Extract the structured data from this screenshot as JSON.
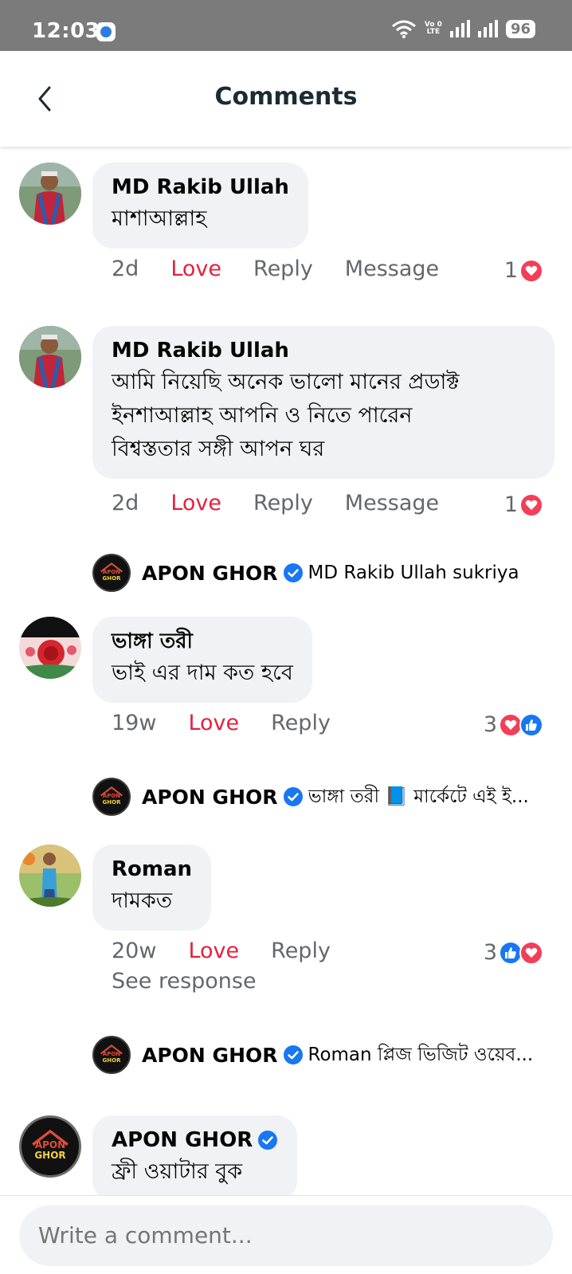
{
  "status_bar": {
    "time": "12:03",
    "lte_top": "Vo 0",
    "lte_bottom": "LTE",
    "battery": "96"
  },
  "header": {
    "title": "Comments"
  },
  "colors": {
    "love": "#e4213f",
    "heart": "#f33e58",
    "like": "#1877f2",
    "bubble": "#f0f2f5",
    "meta": "#65676b"
  },
  "comments": [
    {
      "name": "MD Rakib Ullah",
      "text": [
        "মাশাআল্লাহ"
      ],
      "time": "2d",
      "love_label": "Love",
      "reply_label": "Reply",
      "message_label": "Message",
      "reaction_count": "1",
      "reactions": [
        "heart"
      ]
    },
    {
      "name": "MD Rakib Ullah",
      "text": [
        "আমি নিয়েছি অনেক ভালো মানের প্রডাক্ট",
        "ইনশাআল্লাহ আপনি ও নিতে পারেন",
        "বিশ্বস্ততার সঙ্গী আপন ঘর"
      ],
      "time": "2d",
      "love_label": "Love",
      "reply_label": "Reply",
      "message_label": "Message",
      "reaction_count": "1",
      "reactions": [
        "heart"
      ],
      "reply": {
        "name": "APON GHOR",
        "text": "MD Rakib Ullah sukriya"
      }
    },
    {
      "name": "ভাঙ্গা তরী",
      "text": [
        "ভাই এর দাম কত হবে"
      ],
      "time": "19w",
      "love_label": "Love",
      "reply_label": "Reply",
      "reaction_count": "3",
      "reactions": [
        "heart",
        "like"
      ],
      "reply": {
        "name": "APON GHOR",
        "text": "ভাঙ্গা তরী 📘 মার্কেটে এই ই..."
      }
    },
    {
      "name": "Roman",
      "text": [
        "দামকত"
      ],
      "time": "20w",
      "love_label": "Love",
      "reply_label": "Reply",
      "reaction_count": "3",
      "reactions": [
        "like",
        "heart"
      ],
      "see_response": "See response",
      "reply": {
        "name": "APON GHOR",
        "text": "Roman  প্লিজ ভিজিট ওয়েব..."
      }
    },
    {
      "name": "APON GHOR",
      "text": [
        "ফ্রী ওয়াটার বুক"
      ]
    }
  ],
  "logo": {
    "line1": "APON",
    "line2": "GHOR"
  },
  "composer": {
    "placeholder": "Write a comment..."
  }
}
